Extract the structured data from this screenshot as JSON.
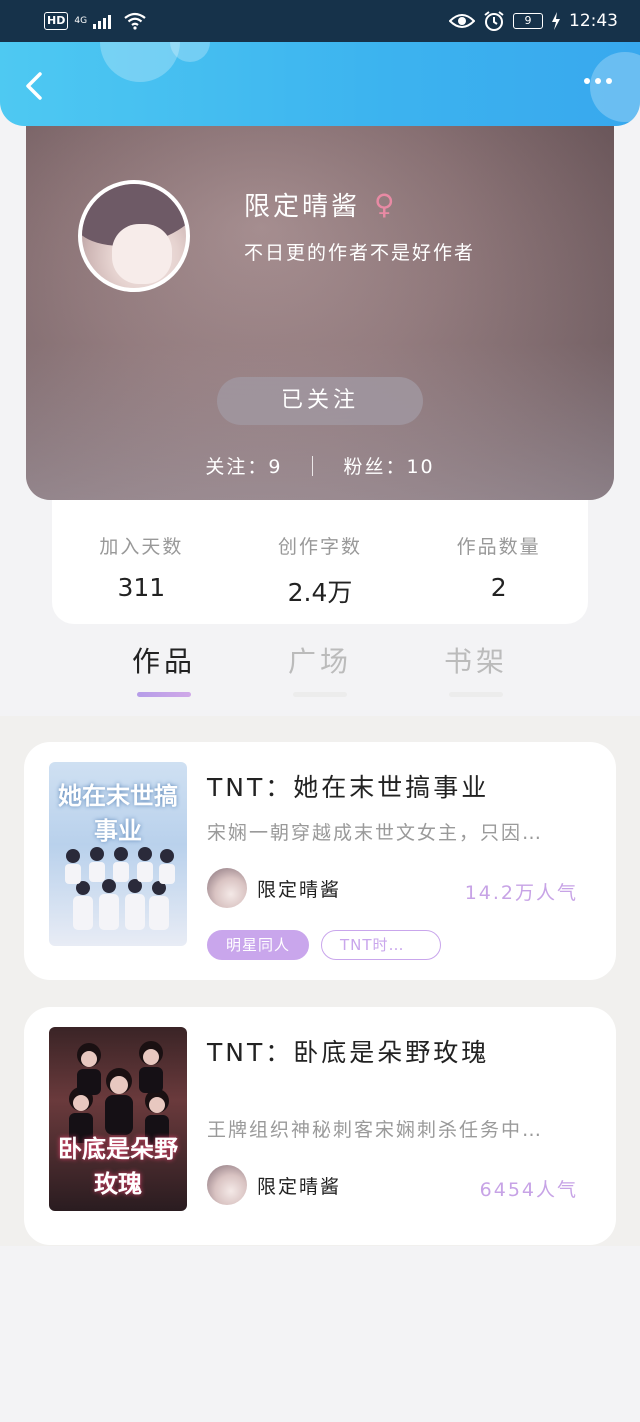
{
  "status_bar": {
    "hd": "HD",
    "network": "4G",
    "battery": "9",
    "time": "12:43"
  },
  "profile": {
    "username": "限定晴酱",
    "gender_symbol": "♀",
    "bio": "不日更的作者不是好作者",
    "follow_label": "已关注",
    "following": "关注：9",
    "fans": "粉丝：10"
  },
  "stats": [
    {
      "label": "加入天数",
      "value": "311"
    },
    {
      "label": "创作字数",
      "value": "2.4万"
    },
    {
      "label": "作品数量",
      "value": "2"
    }
  ],
  "tabs": [
    {
      "label": "作品",
      "active": true
    },
    {
      "label": "广场",
      "active": false
    },
    {
      "label": "书架",
      "active": false
    }
  ],
  "books": [
    {
      "title": "TNT：她在末世搞事业",
      "cover_title": "她在末世搞事业",
      "description": "宋娴一朝穿越成末世文女主，只因…",
      "author": "限定晴酱",
      "readers": "14.2万人气",
      "tags": [
        "明星同人",
        "TNT时…"
      ]
    },
    {
      "title": "TNT：卧底是朵野玫瑰",
      "cover_title": "卧底是朵野玫瑰",
      "description": "王牌组织神秘刺客宋娴刺杀任务中…",
      "author": "限定晴酱",
      "readers": "6454人气",
      "tags": []
    }
  ],
  "colors": {
    "header": "#3cb3ef",
    "accent": "#c9a6ec",
    "gender": "#e88aa4"
  }
}
